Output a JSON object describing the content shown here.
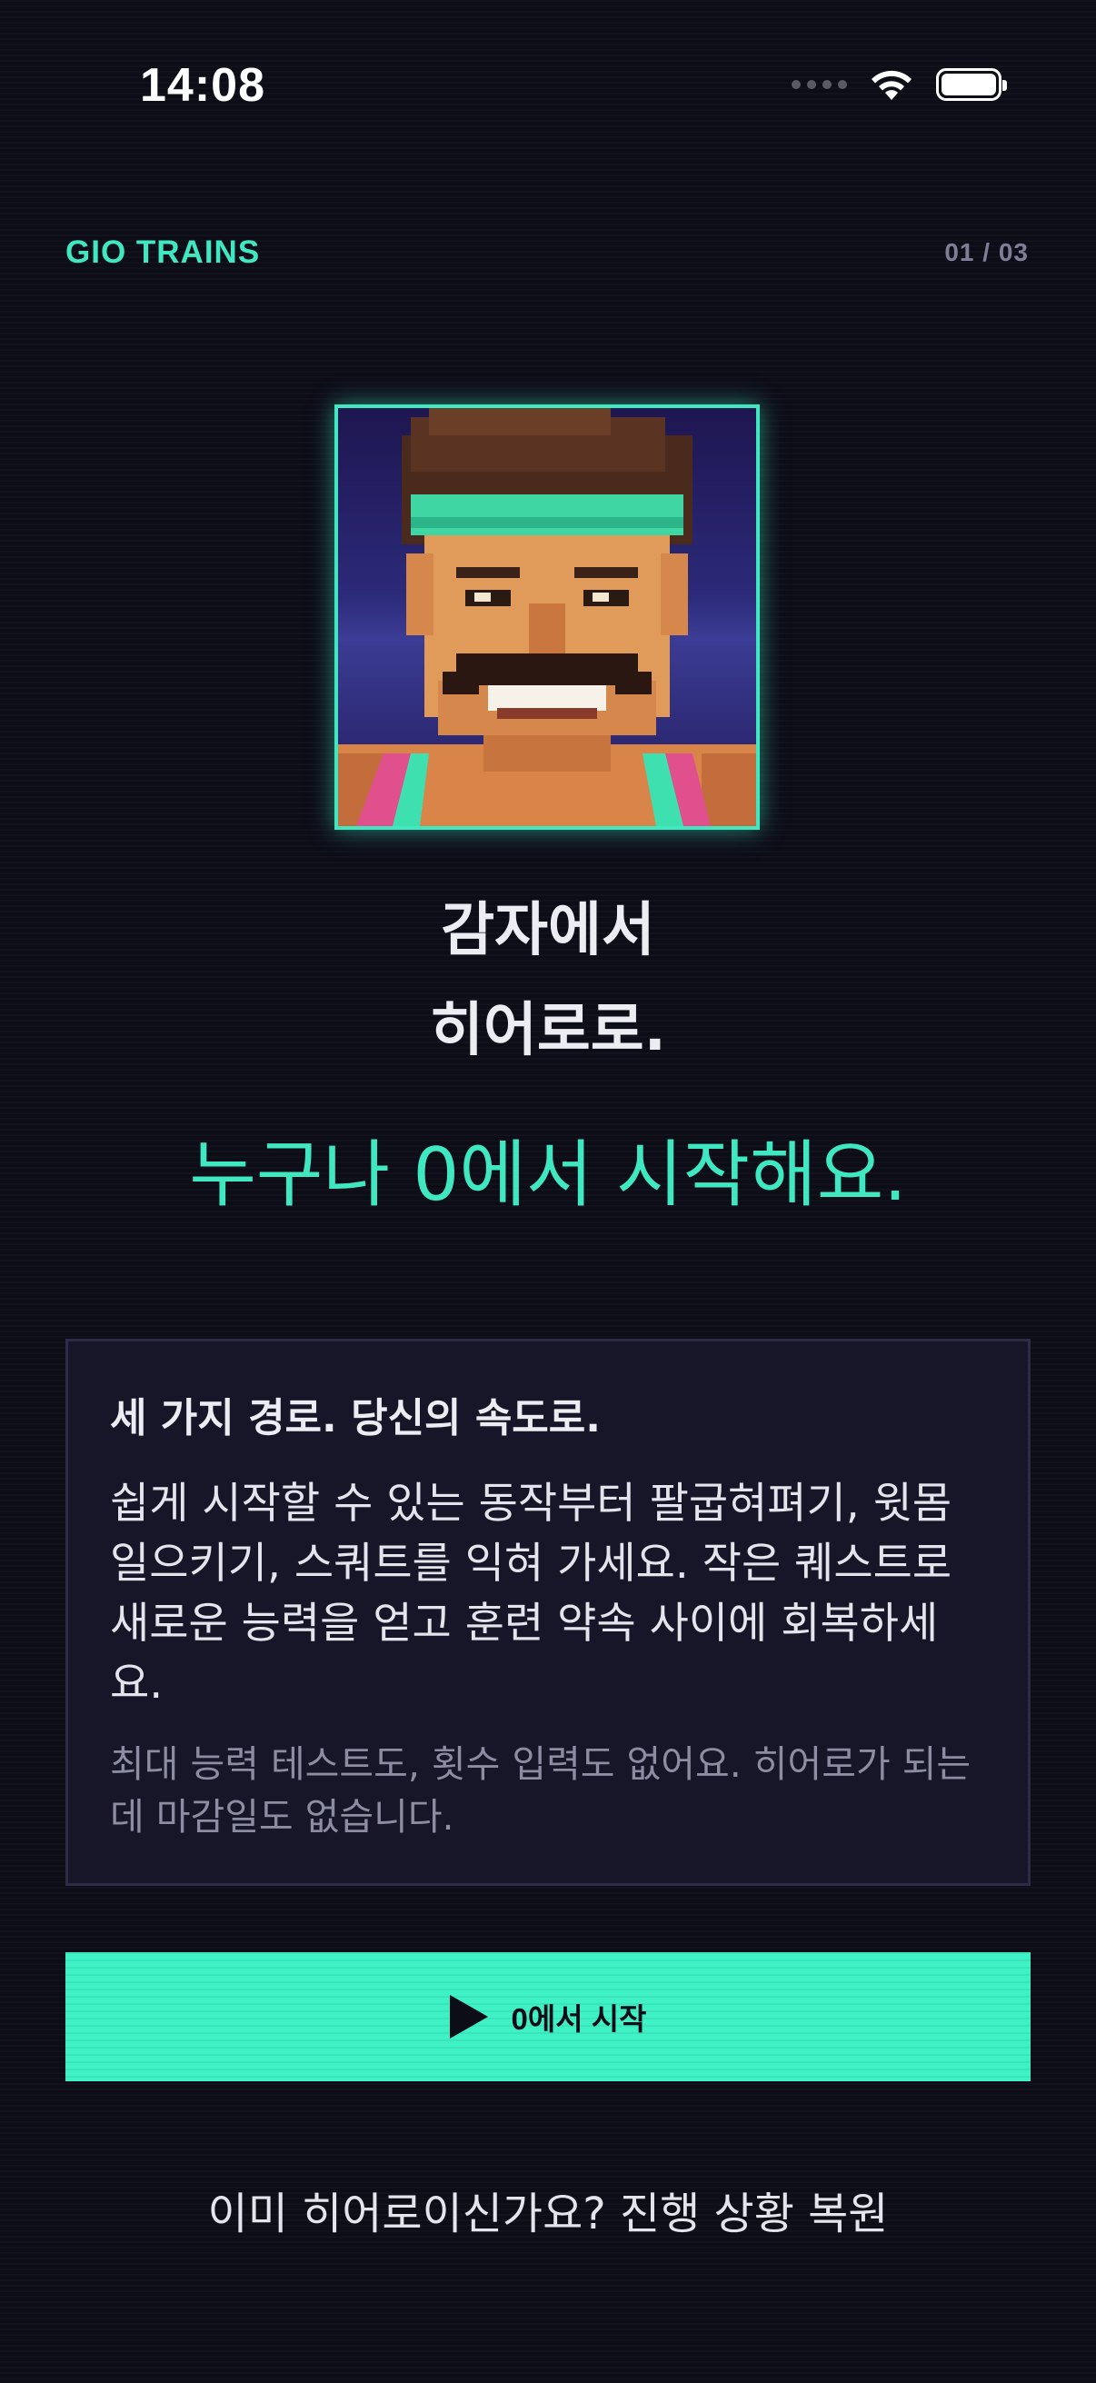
{
  "status_bar": {
    "time": "14:08"
  },
  "header": {
    "app_title": "GIO TRAINS",
    "page_counter": "01 / 03"
  },
  "hero": {
    "headline_line1": "감자에서",
    "headline_line2": "히어로로.",
    "tagline": "누구나 0에서 시작해요."
  },
  "info_card": {
    "title": "세 가지 경로. 당신의 속도로.",
    "body": "쉽게 시작할 수 있는 동작부터 팔굽혀펴기, 윗몸일으키기, 스쿼트를 익혀 가세요. 작은 퀘스트로 새로운 능력을 얻고 훈련 약속 사이에 회복하세요.",
    "note": "최대 능력 테스트도, 횟수 입력도 없어요. 히어로가 되는 데 마감일도 없습니다."
  },
  "cta": {
    "label": "0에서 시작",
    "icon": "play-icon"
  },
  "restore": {
    "label": "이미 히어로이신가요? 진행 상황 복원"
  },
  "colors": {
    "background": "#0d0d18",
    "accent": "#3fe8c0",
    "card_background": "#161628",
    "muted_text": "#8c8ca2"
  }
}
